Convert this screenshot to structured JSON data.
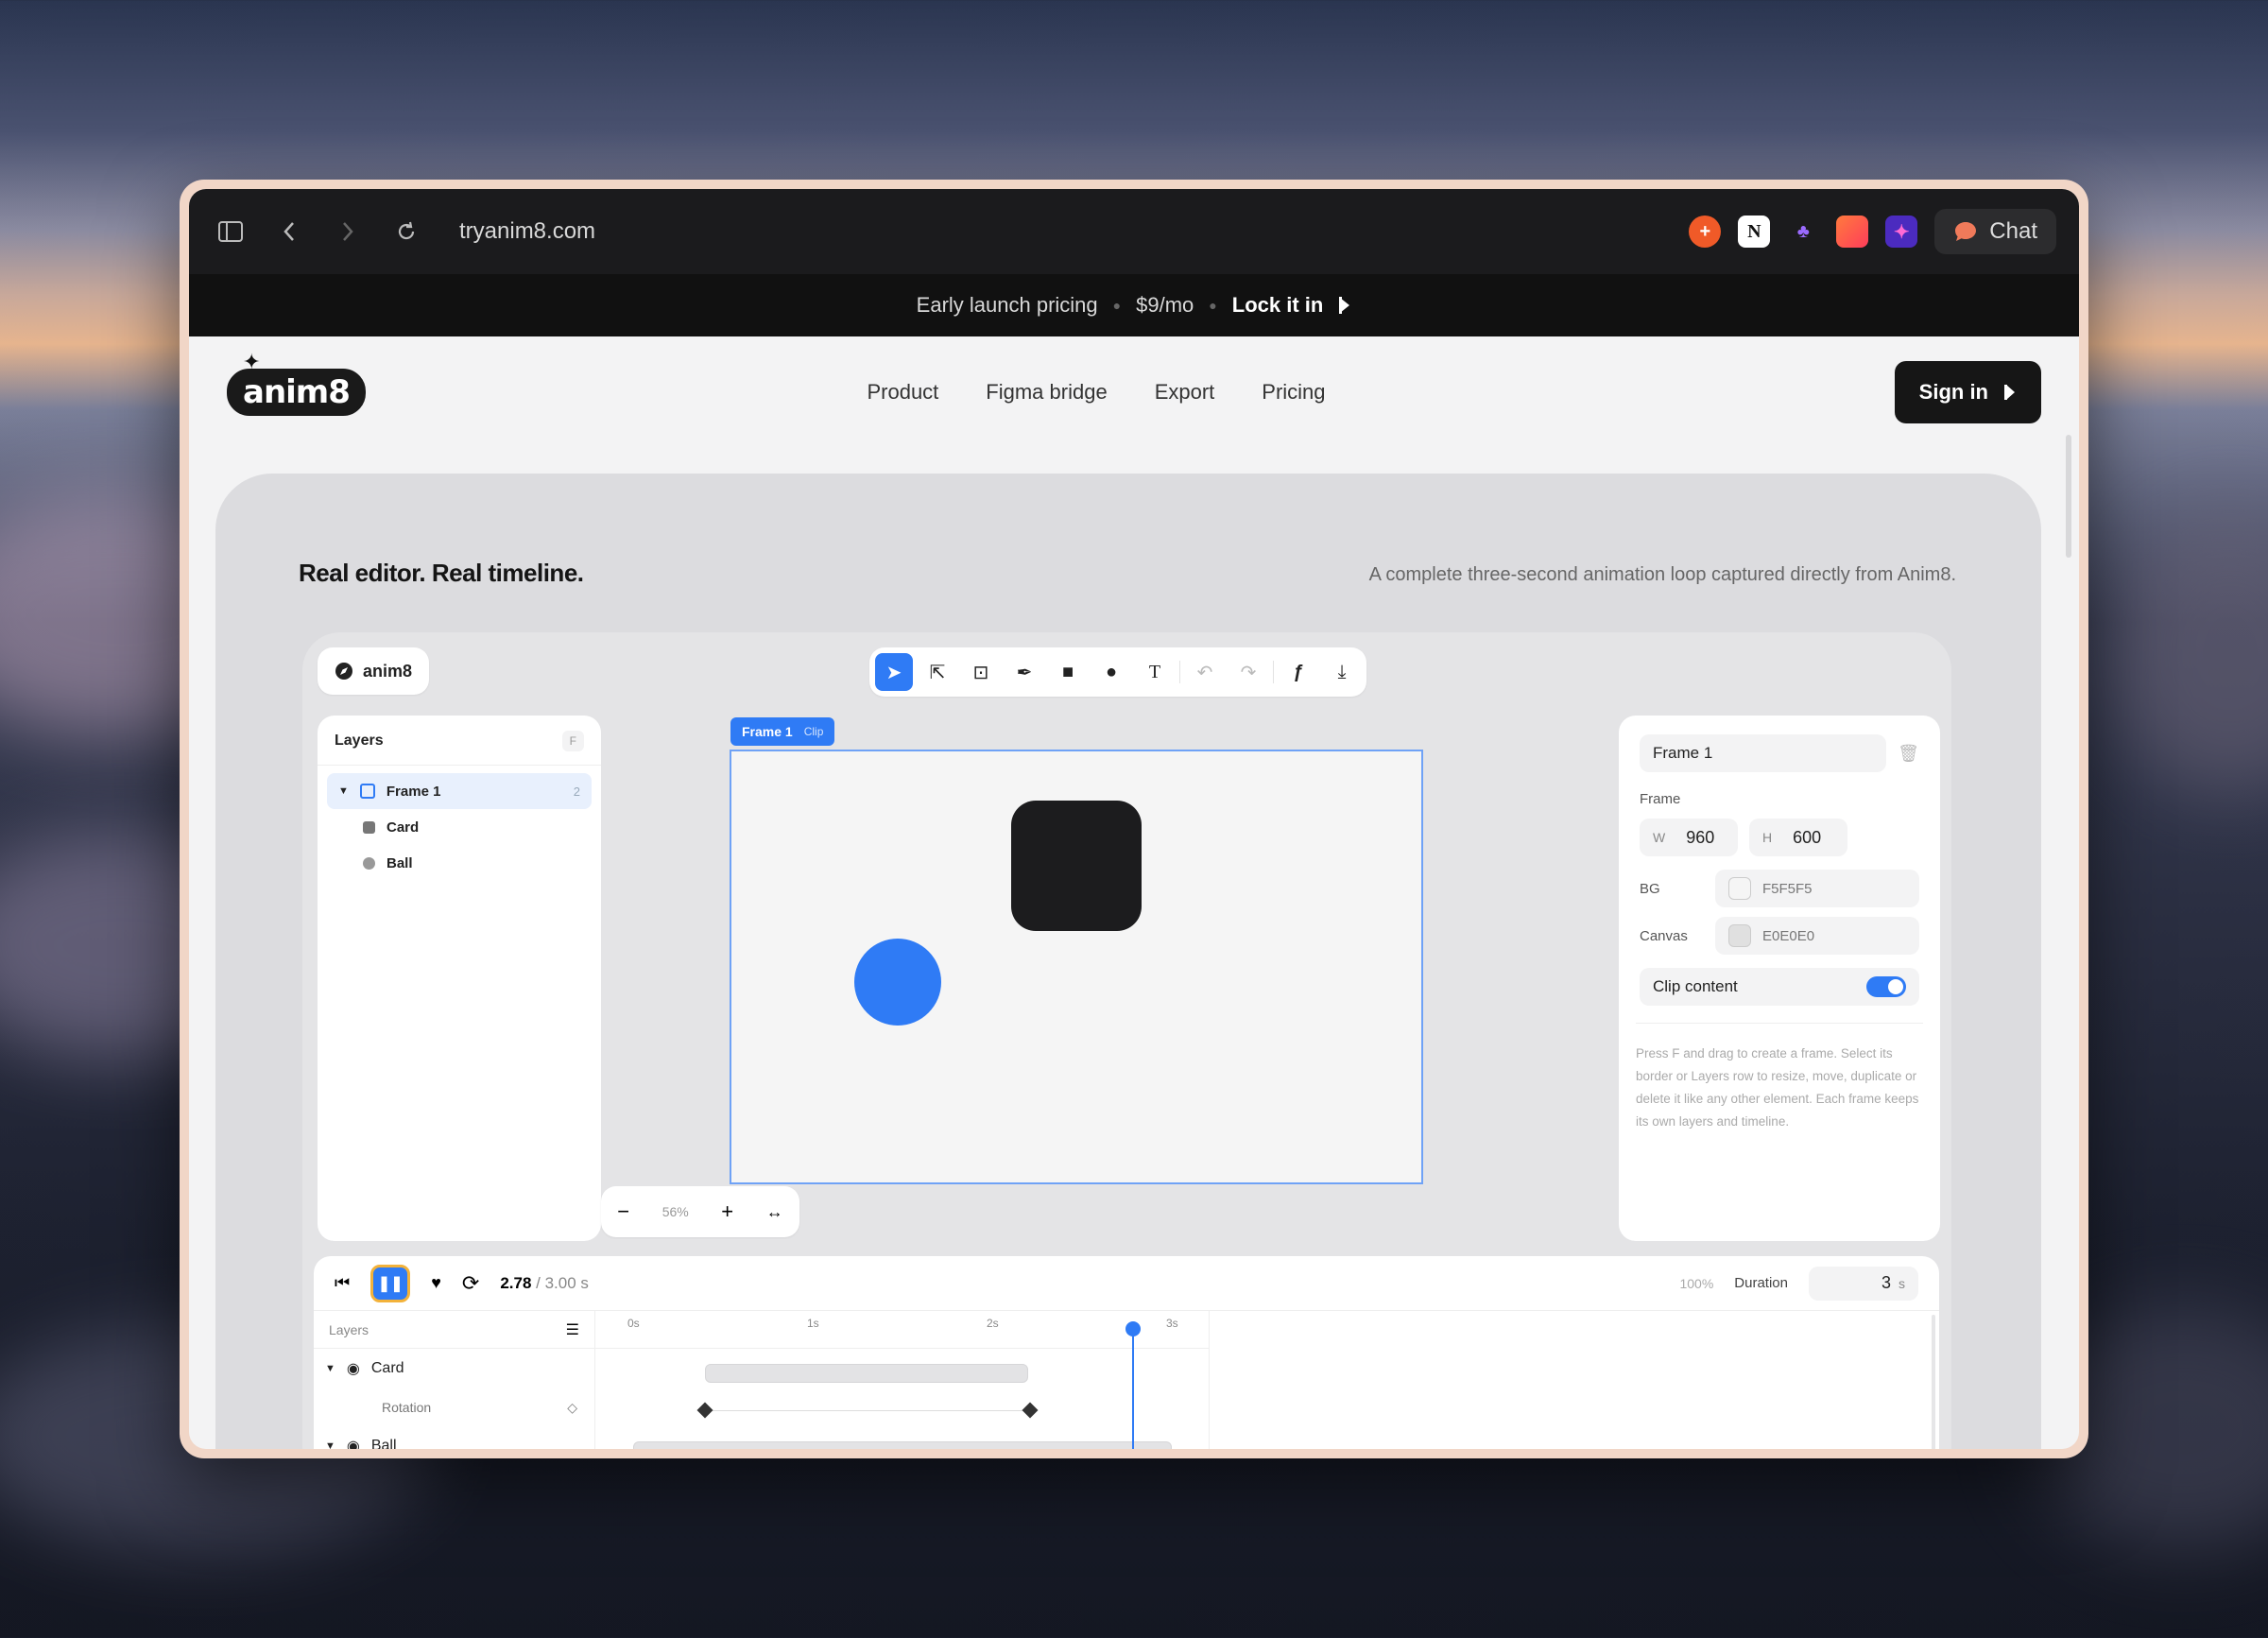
{
  "browser": {
    "url": "tryanim8.com",
    "chat_label": "Chat",
    "extensions": [
      "plus-extension-icon",
      "notion-icon",
      "violet-extension-icon",
      "orange-extension-icon",
      "purple-extension-icon"
    ]
  },
  "banner": {
    "text": "Early launch pricing",
    "price": "$9/mo",
    "cta": "Lock it in"
  },
  "site": {
    "logo": "anim8",
    "nav": [
      "Product",
      "Figma bridge",
      "Export",
      "Pricing"
    ],
    "signin": "Sign in",
    "headline": "Real editor. Real timeline.",
    "subheadline": "A complete three-second animation loop captured directly from Anim8."
  },
  "editor": {
    "brand": "anim8",
    "layers_title": "Layers",
    "layers_shortcut": "F",
    "layers": [
      {
        "name": "Frame 1",
        "count": "2"
      },
      {
        "name": "Card"
      },
      {
        "name": "Ball"
      }
    ],
    "frame_tag": "Frame 1",
    "frame_tag_badge": "Clip",
    "zoom": "56%",
    "props": {
      "name": "Frame 1",
      "section": "Frame",
      "w_label": "W",
      "w": "960",
      "h_label": "H",
      "h": "600",
      "bg_label": "BG",
      "bg": "F5F5F5",
      "canvas_label": "Canvas",
      "canvas": "E0E0E0",
      "clip_label": "Clip content",
      "clip_on": true,
      "help": "Press F and drag to create a frame. Select its border or Layers row to resize, move, duplicate or delete it like any other element. Each frame keeps its own layers and timeline."
    },
    "timeline": {
      "time_current": "2.78",
      "time_total": "/ 3.00 s",
      "speed": "100%",
      "duration_label": "Duration",
      "duration": "3",
      "duration_unit": "s",
      "layers_label": "Layers",
      "ticks": [
        "0s",
        "1s",
        "2s",
        "3s"
      ],
      "rows": [
        {
          "name": "Card",
          "type": "layer"
        },
        {
          "name": "Rotation",
          "type": "property"
        },
        {
          "name": "Ball",
          "type": "layer"
        }
      ],
      "playhead_fraction": 0.927
    },
    "colors": {
      "accent": "#2f7bf5",
      "card": "#1c1c1e",
      "ball": "#2f7bf5",
      "frame_bg": "#F5F5F5"
    }
  }
}
